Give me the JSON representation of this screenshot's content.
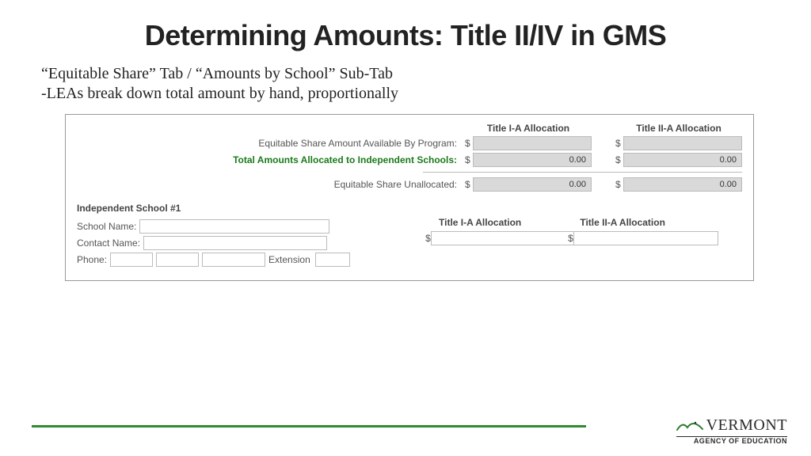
{
  "title": "Determining Amounts: Title II/IV in GMS",
  "sub1": "“Equitable Share” Tab / “Amounts by School” Sub-Tab",
  "sub2": "-LEAs break down total amount by hand, proportionally",
  "headers": {
    "col1": "Title I-A Allocation",
    "col2": "Title II-A Allocation"
  },
  "labels": {
    "available": "Equitable Share Amount Available By Program:",
    "allocated": "Total Amounts Allocated to Independent Schools:",
    "unallocated": "Equitable Share Unallocated:",
    "school_section": "Independent School #1",
    "school_name": "School Name:",
    "contact_name": "Contact Name:",
    "phone": "Phone:",
    "extension": "Extension"
  },
  "values": {
    "available_t1": "",
    "available_t2": "",
    "allocated_t1": "0.00",
    "allocated_t2": "0.00",
    "unallocated_t1": "0.00",
    "unallocated_t2": "0.00",
    "school_name": "",
    "contact_name": "",
    "phone_a": "",
    "phone_b": "",
    "phone_c": "",
    "extension": "",
    "school_t1": "",
    "school_t2": ""
  },
  "brand": {
    "state": "VERMONT",
    "agency": "AGENCY OF EDUCATION"
  }
}
